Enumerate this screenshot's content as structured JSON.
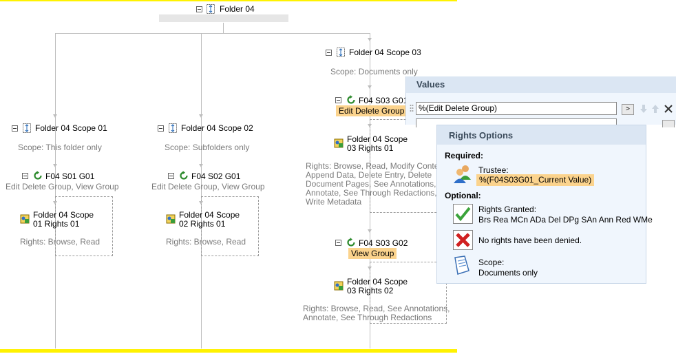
{
  "root": {
    "label": "Folder 04"
  },
  "scopes": [
    {
      "label": "Folder 04 Scope 01",
      "scope_text": "Scope: This folder only",
      "group": {
        "label": "F04 S01 G01",
        "sub": "Edit Delete Group, View Group"
      },
      "rights": {
        "label_line1": "Folder 04 Scope",
        "label_line2": "01 Rights 01",
        "text": "Rights: Browse, Read"
      }
    },
    {
      "label": "Folder 04 Scope 02",
      "scope_text": "Scope: Subfolders only",
      "group": {
        "label": "F04 S02 G01",
        "sub": "Edit Delete Group, View Group"
      },
      "rights": {
        "label_line1": "Folder 04 Scope",
        "label_line2": "02 Rights 01",
        "text": "Rights: Browse, Read"
      }
    },
    {
      "label": "Folder 04 Scope 03",
      "scope_text": "Scope: Documents only",
      "group1": {
        "label": "F04 S03 G01",
        "sub": "Edit Delete Group"
      },
      "rights1": {
        "label_line1": "Folder 04 Scope",
        "label_line2": "03 Rights 01",
        "text_lines": [
          "Rights: Browse, Read, Modify Content,",
          "Append Data, Delete Entry, Delete",
          "Document Pages, See Annotations,",
          "Annotate, See Through Redactions,",
          "Write Metadata"
        ]
      },
      "group2": {
        "label": "F04 S03 G02",
        "sub": "View Group"
      },
      "rights2": {
        "label_line1": "Folder 04 Scope",
        "label_line2": "03 Rights 02",
        "text_lines": [
          "Rights: Browse, Read, See Annotations,",
          "Annotate, See Through Redactions"
        ]
      }
    }
  ],
  "values_panel": {
    "title": "Values",
    "input_value": "%(Edit Delete Group)",
    "expand_label": ">"
  },
  "rights_panel": {
    "title": "Rights Options",
    "required_label": "Required:",
    "trustee_label": "Trustee:",
    "trustee_value": "%(F04S03G01_Current Value)",
    "optional_label": "Optional:",
    "granted_label": "Rights Granted:",
    "granted_value": "Brs Rea MCn ADa Del DPg SAn Ann Red WMe",
    "denied_text": "No rights have been denied.",
    "scope_label": "Scope:",
    "scope_value": "Documents only"
  },
  "colors": {
    "accent_yellow": "#fff200",
    "highlight": "#fbd38d",
    "panel_bg": "#f0f6fd",
    "panel_header": "#dbe6f3"
  }
}
